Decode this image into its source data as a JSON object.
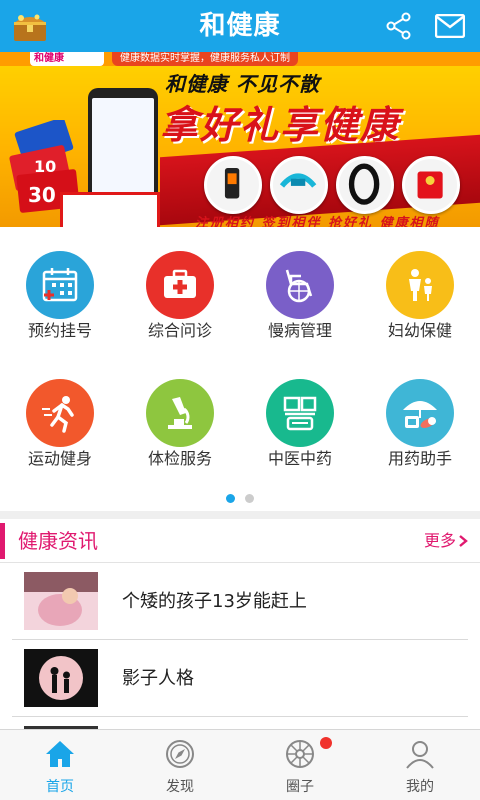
{
  "header": {
    "title": "和健康",
    "left_icon": "treasure-chest-icon",
    "share_icon": "share-icon",
    "mail_icon": "mail-icon"
  },
  "banner": {
    "brand": "和健康",
    "top_note": "健康数据实时掌握，健康服务私人订制",
    "slogan1": "和健康 不见不散",
    "slogan2": "拿好礼享健康",
    "bottom_text": "注册相约 签到相伴 抢好礼 健康相随"
  },
  "grid": {
    "items": [
      {
        "label": "预约挂号",
        "icon": "calendar-icon",
        "color": "#2aa4d9"
      },
      {
        "label": "综合问诊",
        "icon": "medical-kit-icon",
        "color": "#e8302a"
      },
      {
        "label": "慢病管理",
        "icon": "wheelchair-icon",
        "color": "#7a5fc8"
      },
      {
        "label": "妇幼保健",
        "icon": "mother-child-icon",
        "color": "#f8be18"
      },
      {
        "label": "运动健身",
        "icon": "running-icon",
        "color": "#f2582c"
      },
      {
        "label": "体检服务",
        "icon": "microscope-icon",
        "color": "#8ec63f"
      },
      {
        "label": "中医中药",
        "icon": "chinese-medicine-icon",
        "color": "#18b98e"
      },
      {
        "label": "用药助手",
        "icon": "umbrella-pills-icon",
        "color": "#3fb6d6"
      }
    ],
    "page_count": 2,
    "active_page": 1
  },
  "news": {
    "title": "健康资讯",
    "more": "更多",
    "items": [
      {
        "title": "个矮的孩子13岁能赶上"
      },
      {
        "title": "影子人格"
      }
    ]
  },
  "tabbar": {
    "tabs": [
      {
        "label": "首页",
        "icon": "home-icon",
        "active": true
      },
      {
        "label": "发现",
        "icon": "compass-icon",
        "active": false
      },
      {
        "label": "圈子",
        "icon": "wheel-icon",
        "active": false,
        "badge": true
      },
      {
        "label": "我的",
        "icon": "user-icon",
        "active": false
      }
    ]
  },
  "colors": {
    "primary": "#1aa5e8",
    "accent": "#e0196f",
    "badge": "#f0322c"
  }
}
